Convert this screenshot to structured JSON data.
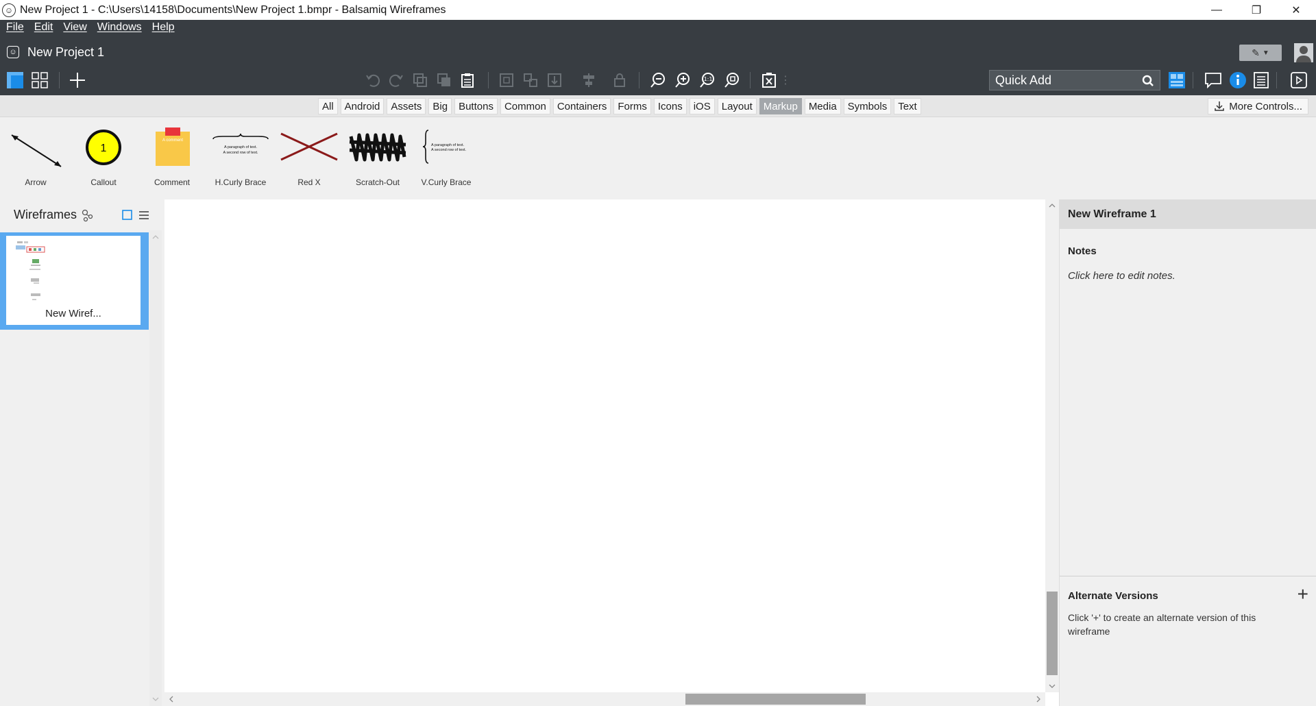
{
  "window": {
    "title": "New Project 1 - C:\\Users\\14158\\Documents\\New Project 1.bmpr - Balsamiq Wireframes",
    "minimize": "—",
    "restore": "❐",
    "close": "✕"
  },
  "menu": [
    "File",
    "Edit",
    "View",
    "Windows",
    "Help"
  ],
  "project": {
    "name": "New Project 1"
  },
  "quick_add": {
    "placeholder": "Quick Add"
  },
  "tabs": [
    "All",
    "Android",
    "Assets",
    "Big",
    "Buttons",
    "Common",
    "Containers",
    "Forms",
    "Icons",
    "iOS",
    "Layout",
    "Markup",
    "Media",
    "Symbols",
    "Text"
  ],
  "active_tab": "Markup",
  "more_controls": "More Controls...",
  "library": [
    {
      "label": "Arrow",
      "icon": "arrow-icon"
    },
    {
      "label": "Callout",
      "icon": "callout-icon",
      "number": "1"
    },
    {
      "label": "Comment",
      "icon": "comment-icon",
      "text": "A comment"
    },
    {
      "label": "H.Curly Brace",
      "icon": "h-curly-brace-icon",
      "text1": "A paragraph of text.",
      "text2": "A second row of text."
    },
    {
      "label": "Red X",
      "icon": "red-x-icon"
    },
    {
      "label": "Scratch-Out",
      "icon": "scratch-out-icon"
    },
    {
      "label": "V.Curly Brace",
      "icon": "v-curly-brace-icon",
      "text1": "A paragraph of text.",
      "text2": "A second row of text."
    }
  ],
  "wireframes_panel": {
    "title": "Wireframes",
    "items": [
      {
        "label": "New Wiref..."
      }
    ]
  },
  "inspector": {
    "title": "New Wireframe 1",
    "notes_title": "Notes",
    "notes_text": "Click here to edit notes.",
    "alt_title": "Alternate Versions",
    "alt_plus": "+",
    "alt_text": "Click '+' to create an alternate version of this wireframe"
  },
  "colors": {
    "toolbar_bg": "#383d42",
    "accent_blue": "#1a8ce8",
    "selection": "#5aa9f0",
    "callout_yellow": "#ffff00",
    "comment_yellow": "#f9c848",
    "red_x": "#8b1a1a"
  }
}
